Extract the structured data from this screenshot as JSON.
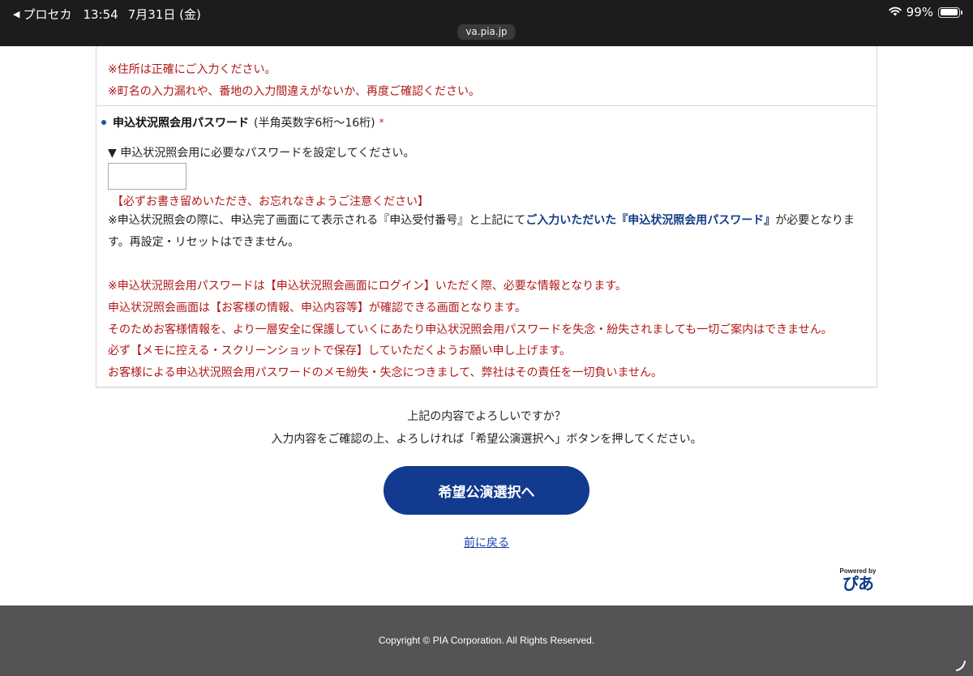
{
  "status_bar": {
    "back_app": "プロセカ",
    "time": "13:54",
    "date": "7月31日 (金)",
    "battery": "99%",
    "battery_level": 0.99,
    "url": "va.pia.jp"
  },
  "address_notes": [
    "※住所は正確にご入力ください。",
    "※町名の入力漏れや、番地の入力間違えがないか、再度ご確認ください。"
  ],
  "password_field": {
    "label": "申込状況照会用パスワード",
    "hint": "(半角英数字6桁〜16桁)",
    "required_mark": "*",
    "instruction": "▼ 申込状況照会用に必要なパスワードを設定してください。",
    "value": "",
    "remember_note": "【必ずお書き留めいただき、お忘れなきようご注意ください】",
    "note_prefix": "※申込状況照会の際に、申込完了画面にて表示される『申込受付番号』と上記にて",
    "note_emphasis": "ご入力いただいた『申込状況照会用パスワード』",
    "note_suffix": "が必要となります。再設定・リセットはできません。"
  },
  "red_notes": [
    "※申込状況照会用パスワードは【申込状況照会画面にログイン】いただく際、必要な情報となります。",
    "申込状況照会画面は【お客様の情報、申込内容等】が確認できる画面となります。",
    "そのためお客様情報を、より一層安全に保護していくにあたり申込状況照会用パスワードを失念・紛失されましても一切ご案内はできません。",
    "必ず【メモに控える・スクリーンショットで保存】していただくようお願い申し上げます。",
    "お客様による申込状況照会用パスワードのメモ紛失・失念につきまして、弊社はその責任を一切負いません。"
  ],
  "confirm": {
    "question": "上記の内容でよろしいですか？",
    "instruction": "入力内容をご確認の上、よろしければ「希望公演選択へ」ボタンを押してください。",
    "next_button": "希望公演選択へ",
    "back_link": "前に戻る"
  },
  "powered_by": {
    "label": "Powered by",
    "logo_text": "ぴあ"
  },
  "footer": {
    "copyright": "Copyright © PIA Corporation. All Rights Reserved."
  },
  "colors": {
    "warning_red": "#b01818",
    "brand_blue": "#123a8f",
    "emphasis_blue": "#123d86",
    "footer_gray": "#545454"
  }
}
